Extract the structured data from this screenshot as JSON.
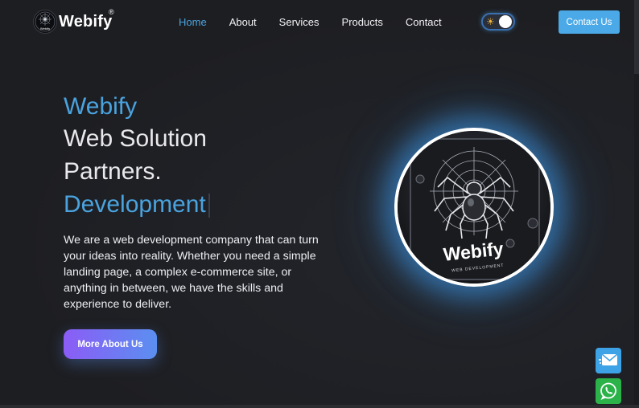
{
  "header": {
    "brand": "Webify",
    "brand_mark": "®",
    "logo_small": "Webify",
    "nav": [
      {
        "label": "Home",
        "active": true
      },
      {
        "label": "About",
        "active": false
      },
      {
        "label": "Services",
        "active": false
      },
      {
        "label": "Products",
        "active": false
      },
      {
        "label": "Contact",
        "active": false
      }
    ],
    "theme_toggle_icon": "sun-icon",
    "contact_label": "Contact Us"
  },
  "hero": {
    "brand": "Webify",
    "line1": "Web Solution",
    "line2": "Partners.",
    "typed": "Development",
    "description": "We are a web development company that can turn your ideas into reality. Whether you need a simple landing page, a complex e-commerce site, or anything in between, we have the skills and experience to deliver.",
    "cta_label": "More About Us",
    "image_text": "Webify",
    "image_subtext": "WEB DEVELOPMENT"
  },
  "floating": {
    "mail_icon": "mail-icon",
    "whatsapp_icon": "whatsapp-icon"
  },
  "colors": {
    "accent": "#4aa3df",
    "background": "#1f2024",
    "contact_button": "#4aa9e6",
    "cta_gradient_start": "#8b5cf6",
    "cta_gradient_end": "#5b8ff0",
    "whatsapp": "#2bb34a"
  }
}
